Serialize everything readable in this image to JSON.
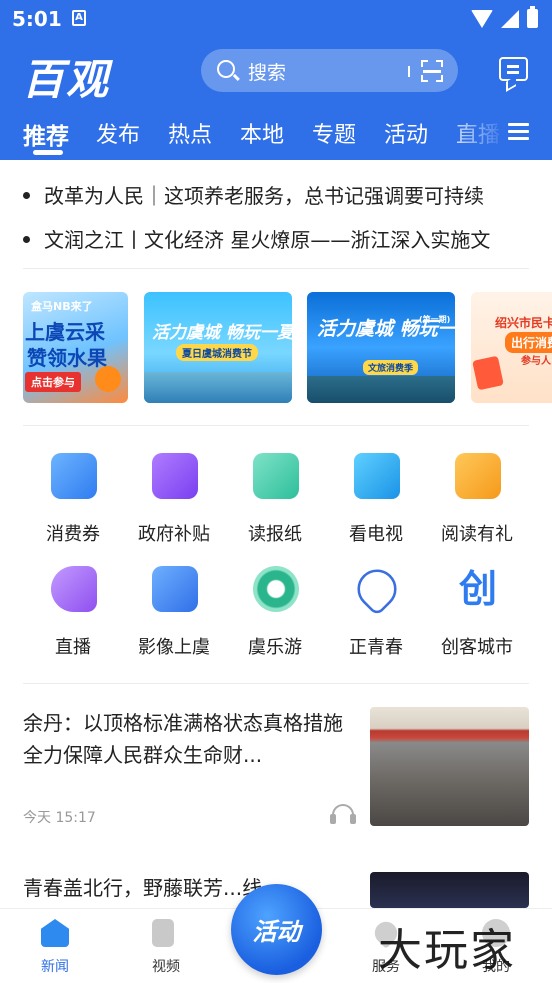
{
  "status": {
    "time": "5:01",
    "indicator": "A"
  },
  "header": {
    "logo": "百观",
    "search_placeholder": "搜索",
    "search_divider": "|"
  },
  "tabs": [
    {
      "label": "推荐",
      "active": true
    },
    {
      "label": "发布"
    },
    {
      "label": "热点"
    },
    {
      "label": "本地"
    },
    {
      "label": "专题"
    },
    {
      "label": "活动"
    },
    {
      "label": "直播"
    }
  ],
  "headlines": [
    "改革为人民｜这项养老服务，总书记强调要可持续",
    "文润之江丨文化经济 星火燎原——浙江深入实施文"
  ],
  "banners": [
    {
      "title": "上虞云采",
      "subtitle": "赞领水果",
      "tag": "点击参与",
      "top": "盒马NB来了"
    },
    {
      "title": "活力虞城 畅玩一夏",
      "subtitle": "夏日虞城消费节"
    },
    {
      "title": "活力虞城 畅玩一夏",
      "subtitle": "文旅消费季",
      "tag": "(第一期)"
    },
    {
      "title": "绍兴市民卡",
      "subtitle": "出行消费",
      "tag": "参与人"
    }
  ],
  "services": [
    {
      "label": "消费券",
      "icon": "voucher-icon",
      "color": "#3d8bff"
    },
    {
      "label": "政府补贴",
      "icon": "subsidy-icon",
      "color": "#8a4ff0"
    },
    {
      "label": "读报纸",
      "icon": "newspaper-icon",
      "color": "#34c7a4"
    },
    {
      "label": "看电视",
      "icon": "tv-icon",
      "color": "#1aa3f0"
    },
    {
      "label": "阅读有礼",
      "icon": "reading-gift-icon",
      "color": "#f5a623"
    },
    {
      "label": "直播",
      "icon": "live-camera-icon",
      "color": "#9b5cf0"
    },
    {
      "label": "影像上虞",
      "icon": "camera-icon",
      "color": "#2f7cf0"
    },
    {
      "label": "虞乐游",
      "icon": "travel-swirl-icon",
      "color": "#2bb58c"
    },
    {
      "label": "正青春",
      "icon": "youth-star-icon",
      "color": "#3a6fe0"
    },
    {
      "label": "创客城市",
      "icon": "maker-city-icon",
      "color": "#2f7cf0"
    }
  ],
  "news": [
    {
      "title": "余丹：以顶格标准满格状态真格措施 全力保障人民群众生命财...",
      "time": "今天 15:17"
    },
    {
      "title": "青春盖北行，野藤联芳...线"
    }
  ],
  "bottom_nav": [
    {
      "label": "新闻",
      "active": true,
      "icon": "news-home-icon"
    },
    {
      "label": "视频",
      "icon": "video-icon"
    },
    {
      "label": "活动",
      "icon": "activity-center-icon"
    },
    {
      "label": "服务",
      "icon": "service-heart-icon"
    },
    {
      "label": "我的",
      "icon": "profile-icon"
    }
  ],
  "watermark": "大玩家",
  "accent_color": "#2f6fe8"
}
